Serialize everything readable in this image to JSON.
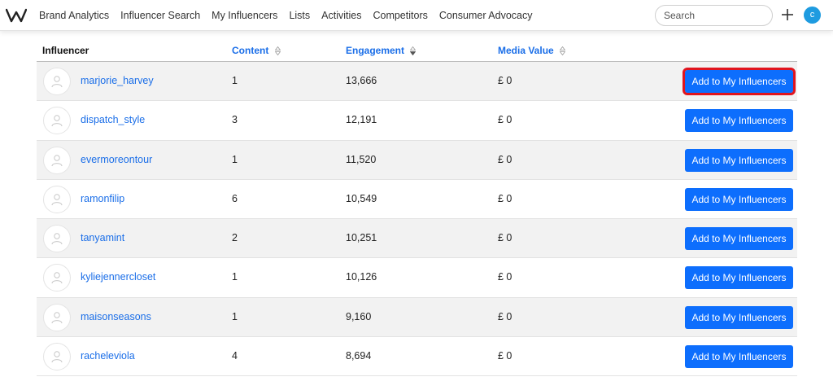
{
  "nav": {
    "items": [
      "Brand Analytics",
      "Influencer Search",
      "My Influencers",
      "Lists",
      "Activities",
      "Competitors",
      "Consumer Advocacy"
    ],
    "search_placeholder": "Search",
    "avatar_letter": "c",
    "accent_color": "#1e9be0"
  },
  "table": {
    "headers": {
      "influencer": "Influencer",
      "content": "Content",
      "engagement": "Engagement",
      "media_value": "Media Value"
    },
    "button_label": "Add to My Influencers",
    "rows": [
      {
        "name": "marjorie_harvey",
        "content": "1",
        "engagement": "13,666",
        "media_value": "£ 0",
        "highlighted": true
      },
      {
        "name": "dispatch_style",
        "content": "3",
        "engagement": "12,191",
        "media_value": "£ 0"
      },
      {
        "name": "evermoreontour",
        "content": "1",
        "engagement": "11,520",
        "media_value": "£ 0"
      },
      {
        "name": "ramonfilip",
        "content": "6",
        "engagement": "10,549",
        "media_value": "£ 0"
      },
      {
        "name": "tanyamint",
        "content": "2",
        "engagement": "10,251",
        "media_value": "£ 0"
      },
      {
        "name": "kyliejennercloset",
        "content": "1",
        "engagement": "10,126",
        "media_value": "£ 0"
      },
      {
        "name": "maisonseasons",
        "content": "1",
        "engagement": "9,160",
        "media_value": "£ 0"
      },
      {
        "name": "racheleviola",
        "content": "4",
        "engagement": "8,694",
        "media_value": "£ 0"
      }
    ]
  }
}
